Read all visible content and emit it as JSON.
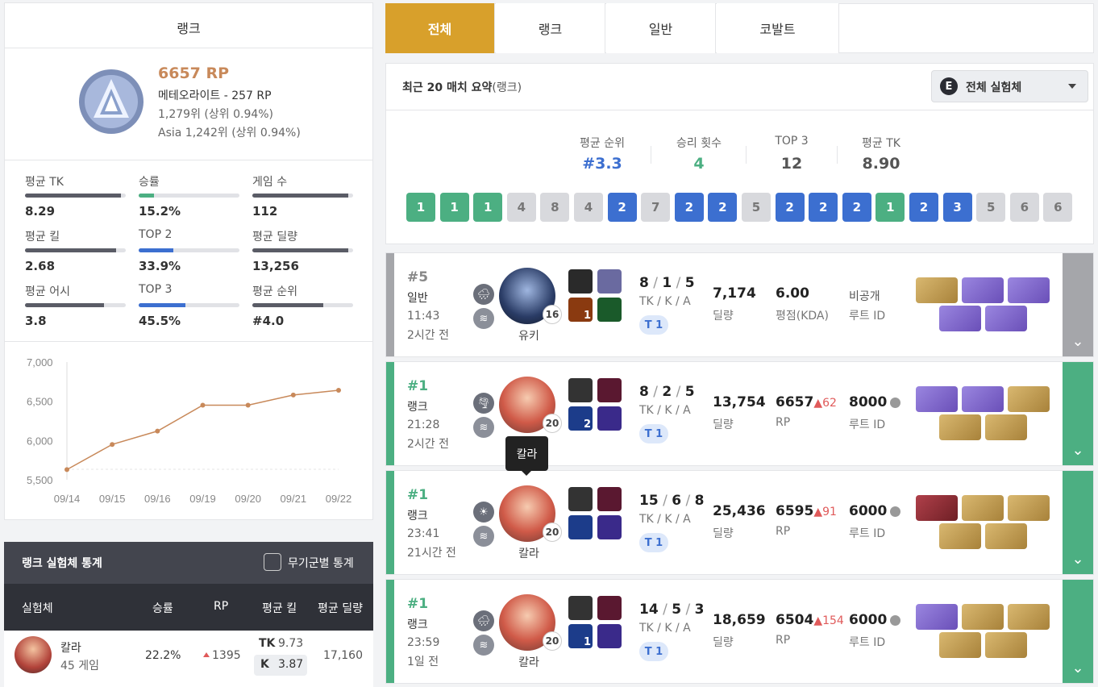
{
  "rank_card": {
    "title": "랭크",
    "rp": "6657 RP",
    "tier": "메테오라이트 - 257 RP",
    "rank_global": "1,279위 (상위 0.94%)",
    "rank_region": "Asia 1,242위 (상위 0.94%)"
  },
  "stats": [
    {
      "label": "평균 TK",
      "value": "8.29",
      "fill": 0.95,
      "color": "#5a5c66"
    },
    {
      "label": "승률",
      "value": "15.2%",
      "fill": 0.15,
      "color": "#4caf82"
    },
    {
      "label": "게임 수",
      "value": "112",
      "fill": 0.95,
      "color": "#5a5c66"
    },
    {
      "label": "평균 킬",
      "value": "2.68",
      "fill": 0.9,
      "color": "#5a5c66"
    },
    {
      "label": "TOP 2",
      "value": "33.9%",
      "fill": 0.34,
      "color": "#3c6fd0"
    },
    {
      "label": "평균 딜량",
      "value": "13,256",
      "fill": 0.95,
      "color": "#5a5c66"
    },
    {
      "label": "평균 어시",
      "value": "3.8",
      "fill": 0.78,
      "color": "#5a5c66"
    },
    {
      "label": "TOP 3",
      "value": "45.5%",
      "fill": 0.46,
      "color": "#3c6fd0"
    },
    {
      "label": "평균 순위",
      "value": "#4.0",
      "fill": 0.7,
      "color": "#5a5c66"
    }
  ],
  "chart_data": {
    "type": "line",
    "x": [
      "09/14",
      "09/15",
      "09/16",
      "09/19",
      "09/20",
      "09/21",
      "09/22"
    ],
    "values": [
      5630,
      5950,
      6120,
      6450,
      6450,
      6580,
      6640
    ],
    "yticks": [
      "7,000",
      "6,500",
      "6,000",
      "5,500"
    ],
    "ylim": [
      5500,
      7000
    ],
    "color": "#c8895a"
  },
  "char_stats": {
    "title": "랭크 실험체 통계",
    "weapon_toggle": "무기군별 통계",
    "headers": [
      "실험체",
      "승률",
      "RP",
      "평균 킬",
      "평균 딜량"
    ],
    "rows": [
      {
        "name": "칼라",
        "games": "45 게임",
        "winrate": "22.2%",
        "rp": "1395",
        "tk_label": "TK",
        "tk": "9.73",
        "k_label": "K",
        "k": "3.87",
        "damage": "17,160"
      }
    ]
  },
  "tabs": [
    "전체",
    "랭크",
    "일반",
    "코발트"
  ],
  "summary": {
    "title": "최근 20 매치 요약",
    "title_suffix": "(랭크)",
    "filter": "전체 실험체",
    "filter_icon": "E",
    "stats": [
      {
        "label": "평균 순위",
        "value": "#3.3",
        "color": "#3c6fd0"
      },
      {
        "label": "승리 횟수",
        "value": "4",
        "color": "#4caf82"
      },
      {
        "label": "TOP 3",
        "value": "12",
        "color": "#555"
      },
      {
        "label": "평균 TK",
        "value": "8.90",
        "color": "#555"
      }
    ],
    "recent": [
      "1",
      "1",
      "1",
      "4",
      "8",
      "4",
      "2",
      "7",
      "2",
      "2",
      "5",
      "2",
      "2",
      "2",
      "1",
      "2",
      "3",
      "5",
      "6",
      "6"
    ]
  },
  "tooltip": "칼라",
  "matches": [
    {
      "rank": "#5",
      "mode": "일반",
      "time": "11:43",
      "ago": "2시간 전",
      "level": "16",
      "char": "유키",
      "tka": [
        "8",
        "1",
        "5"
      ],
      "tka_label": "TK / K / A",
      "tier": "T 1",
      "damage": "7,174",
      "damage_label": "딜량",
      "rp": "6.00",
      "rp_delta": "",
      "rp_label": "평점(KDA)",
      "loot": "비공개",
      "loot_label": "루트 ID",
      "color": "#a5a6aa",
      "weather1": "🌧",
      "weather2": "≋",
      "skill_num": "1",
      "items": [
        "gold",
        "purple",
        "purple",
        "purple",
        "purple"
      ]
    },
    {
      "rank": "#1",
      "mode": "랭크",
      "time": "21:28",
      "ago": "2시간 전",
      "level": "20",
      "char": "",
      "tka": [
        "8",
        "2",
        "5"
      ],
      "tka_label": "TK / K / A",
      "tier": "T 1",
      "damage": "13,754",
      "damage_label": "딜량",
      "rp": "6657",
      "rp_delta": "▲62",
      "rp_label": "RP",
      "loot": "8000",
      "loot_label": "루트 ID",
      "color": "#4caf82",
      "weather1": "🌪",
      "weather2": "≋",
      "skill_num": "2",
      "items": [
        "purple",
        "purple",
        "gold",
        "gold",
        "gold"
      ]
    },
    {
      "rank": "#1",
      "mode": "랭크",
      "time": "23:41",
      "ago": "21시간 전",
      "level": "20",
      "char": "칼라",
      "tka": [
        "15",
        "6",
        "8"
      ],
      "tka_label": "TK / K / A",
      "tier": "T 1",
      "damage": "25,436",
      "damage_label": "딜량",
      "rp": "6595",
      "rp_delta": "▲91",
      "rp_label": "RP",
      "loot": "6000",
      "loot_label": "루트 ID",
      "color": "#4caf82",
      "weather1": "☀",
      "weather2": "≋",
      "skill_num": "",
      "items": [
        "red",
        "gold",
        "gold",
        "gold",
        "gold"
      ]
    },
    {
      "rank": "#1",
      "mode": "랭크",
      "time": "23:59",
      "ago": "1일 전",
      "level": "20",
      "char": "칼라",
      "tka": [
        "14",
        "5",
        "3"
      ],
      "tka_label": "TK / K / A",
      "tier": "T 1",
      "damage": "18,659",
      "damage_label": "딜량",
      "rp": "6504",
      "rp_delta": "▲154",
      "rp_label": "RP",
      "loot": "6000",
      "loot_label": "루트 ID",
      "color": "#4caf82",
      "weather1": "🌧",
      "weather2": "≋",
      "skill_num": "1",
      "items": [
        "purple",
        "gold",
        "gold",
        "gold",
        "gold"
      ]
    }
  ],
  "expand_icon": "⌄"
}
